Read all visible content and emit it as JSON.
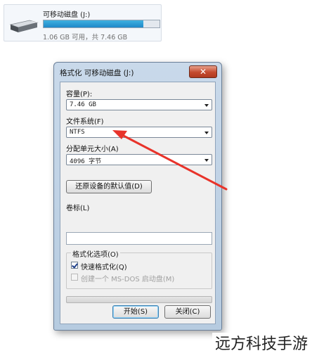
{
  "drive": {
    "name": "可移动磁盘 (J:)",
    "info": "1.06 GB 可用，共 7.46 GB",
    "used_fraction": 0.858,
    "icon": "usb-drive-icon"
  },
  "dialog": {
    "title": "格式化 可移动磁盘 (J:)",
    "close_symbol": "✕",
    "capacity": {
      "label": "容量(P):",
      "value": "7.46 GB"
    },
    "filesystem": {
      "label": "文件系统(F)",
      "value": "NTFS"
    },
    "allocation": {
      "label": "分配单元大小(A)",
      "value": "4096 字节"
    },
    "restore_defaults": "还原设备的默认值(D)",
    "volume_label": {
      "label": "卷标(L)",
      "value": ""
    },
    "format_options": {
      "title": "格式化选项(O)",
      "quick_format": {
        "label": "快速格式化(Q)",
        "checked": true,
        "enabled": true
      },
      "msdos_disk": {
        "label": "创建一个 MS-DOS 启动盘(M)",
        "checked": false,
        "enabled": false
      }
    },
    "progress": 0,
    "start_button": "开始(S)",
    "close_button": "关闭(C)"
  },
  "annotation": {
    "color": "#e8332a"
  },
  "watermark": "远方科技手游",
  "colors": {
    "title_bar": "#c9d9ea",
    "drive_bar": "#1f88c8",
    "close_button": "#c44a2e"
  }
}
